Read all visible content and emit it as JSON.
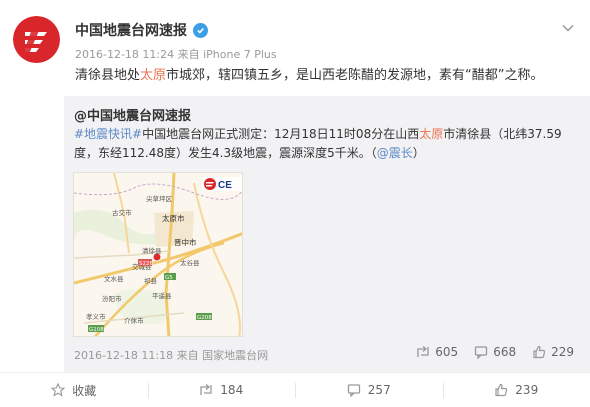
{
  "post": {
    "author": "中国地震台网速报",
    "verified_badge": "verified-icon",
    "meta": "2016-12-18 11:24 来自 iPhone 7 Plus",
    "text_before": "清徐县地处",
    "text_highlight": "太原",
    "text_after": "市城郊，辖四镇五乡，是山西老陈醋的发源地，素有“醋都”之称。"
  },
  "repost": {
    "author": "@中国地震台网速报",
    "tag": "#地震快讯#",
    "text_1": "中国地震台网正式测定：12月18日11时08分在山西",
    "text_hl": "太原",
    "text_2": "市清徐县（北纬37.59度，东经112.48度）发生4.3级地震，震源深度5千米。（",
    "text_link": "@震长",
    "text_3": "）",
    "meta": "2016-12-18 11:18 来自 国家地震台网",
    "stats": {
      "repost": "605",
      "comment": "668",
      "like": "229"
    },
    "map": {
      "brand": "CE",
      "labels": [
        "尖草坪区",
        "古交市",
        "太原市",
        "晋中市",
        "清徐县",
        "文水县",
        "交城县",
        "平遥县",
        "汾阳市",
        "孝义市",
        "介休市",
        "祁县",
        "太谷县"
      ],
      "roads": [
        "G5",
        "G208",
        "G307",
        "G108",
        "G20",
        "S226"
      ]
    }
  },
  "actions": {
    "favorite": "收藏",
    "repost": "184",
    "comment": "257",
    "like": "239"
  },
  "colors": {
    "accent": "#eb7350",
    "link": "#5d8ac4",
    "badge": "#3b9fe5"
  }
}
